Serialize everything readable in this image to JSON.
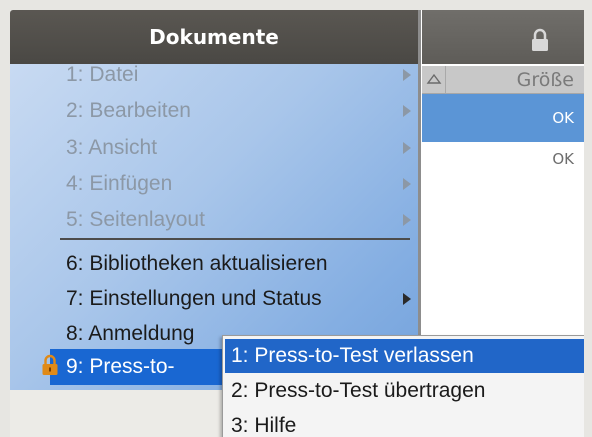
{
  "menu": {
    "title": "Dokumente",
    "items": [
      {
        "label": "1: Datei",
        "enabled": false,
        "submenu": true
      },
      {
        "label": "2: Bearbeiten",
        "enabled": false,
        "submenu": true
      },
      {
        "label": "3: Ansicht",
        "enabled": false,
        "submenu": true
      },
      {
        "label": "4: Einfügen",
        "enabled": false,
        "submenu": true
      },
      {
        "label": "5: Seitenlayout",
        "enabled": false,
        "submenu": true
      },
      {
        "label": "6: Bibliotheken aktualisieren",
        "enabled": true,
        "submenu": false
      },
      {
        "label": "7: Einstellungen und Status",
        "enabled": true,
        "submenu": true
      },
      {
        "label": "8: Anmeldung",
        "enabled": true,
        "submenu": false
      },
      {
        "label": "9: Press-to-",
        "enabled": true,
        "submenu": true,
        "selected": true
      }
    ]
  },
  "submenu": {
    "items": [
      {
        "label": "1: Press-to-Test verlassen",
        "selected": true
      },
      {
        "label": "2: Press-to-Test übertragen",
        "selected": false
      },
      {
        "label": "3: Hilfe",
        "selected": false
      }
    ]
  },
  "file_list": {
    "column_header": "Größe",
    "rows": [
      {
        "size": "OK",
        "selected": true
      },
      {
        "size": "OK",
        "selected": false
      }
    ]
  },
  "colors": {
    "selection": "#1967d2",
    "menu_bg": "#a9c6ea",
    "header_bg": "#4a4844",
    "lock_icon": "#e08a18"
  },
  "icons": [
    "lock-icon",
    "sort-up-icon",
    "chevron-right-icon"
  ]
}
